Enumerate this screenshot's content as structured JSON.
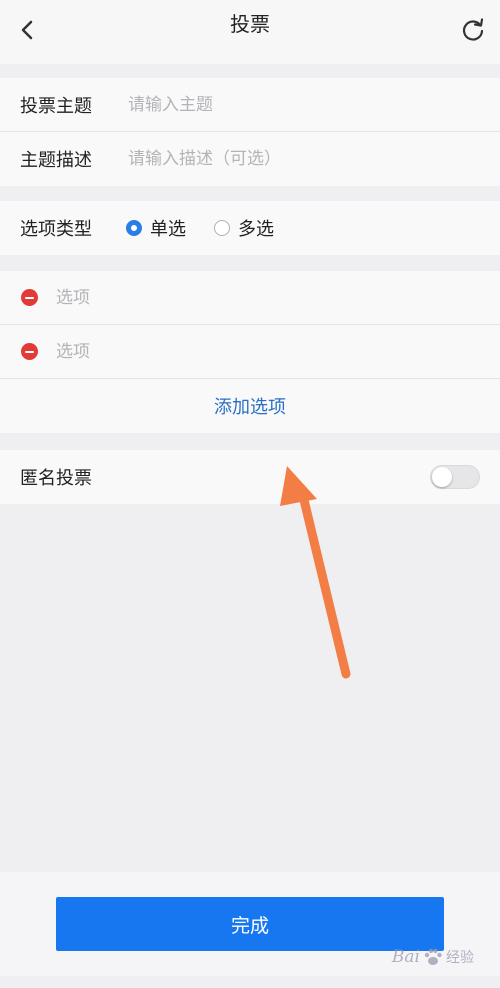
{
  "header": {
    "title": "投票",
    "back_icon": "chevron-left-icon",
    "refresh_icon": "refresh-icon"
  },
  "form": {
    "topic": {
      "label": "投票主题",
      "placeholder": "请输入主题",
      "value": ""
    },
    "description": {
      "label": "主题描述",
      "placeholder": "请输入描述（可选）",
      "value": ""
    },
    "option_type": {
      "label": "选项类型",
      "options": [
        "单选",
        "多选"
      ],
      "selected": "单选"
    },
    "options": [
      {
        "placeholder": "选项",
        "value": ""
      },
      {
        "placeholder": "选项",
        "value": ""
      }
    ],
    "add_option_label": "添加选项",
    "anonymous": {
      "label": "匿名投票",
      "enabled": false
    }
  },
  "footer": {
    "done_label": "完成"
  },
  "watermark": {
    "latin": "Bai",
    "cn": "经验"
  },
  "colors": {
    "accent": "#1677f0",
    "link": "#2a6fc4",
    "remove": "#e23a36",
    "arrow": "#f27e45"
  }
}
